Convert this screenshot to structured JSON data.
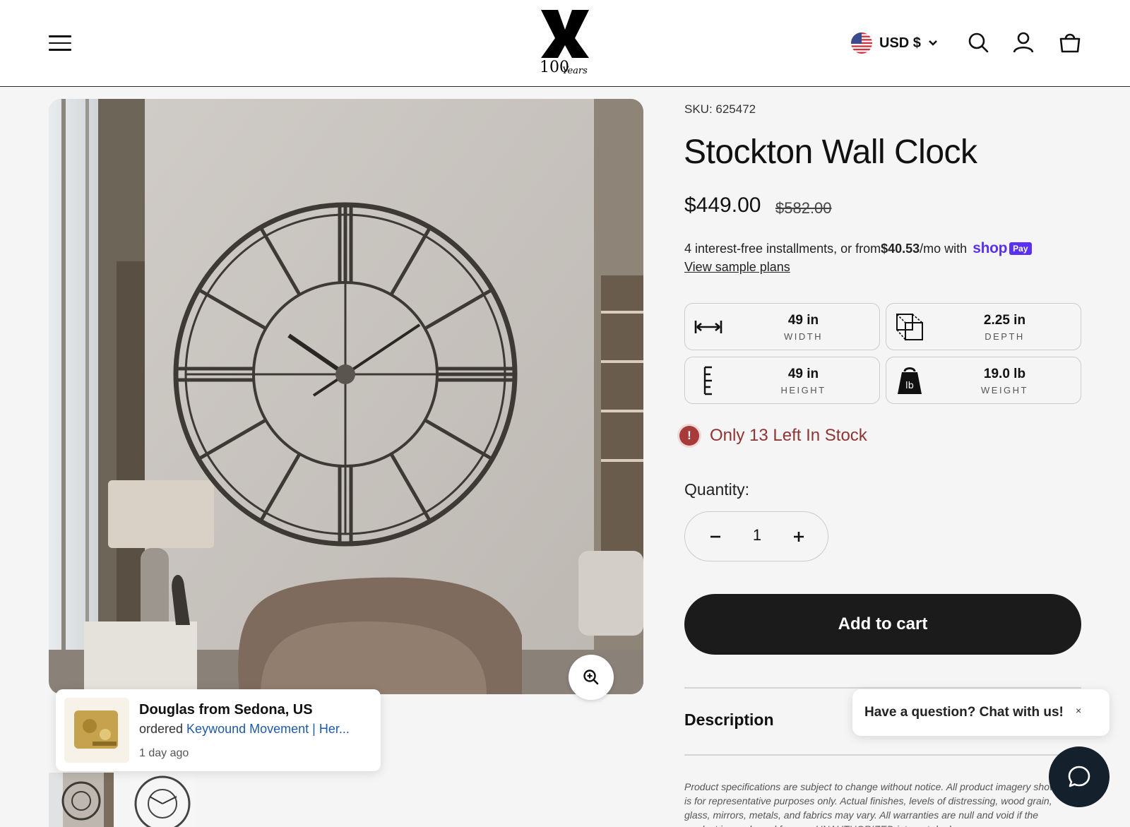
{
  "header": {
    "currency_label": "USD $",
    "logo_text": "100 Years"
  },
  "product": {
    "sku": "SKU: 625472",
    "title": "Stockton Wall Clock",
    "price": "$449.00",
    "compare_price": "$582.00",
    "installments_prefix": "4 interest-free installments, or from ",
    "installments_amount": "$40.53",
    "installments_suffix": "/mo with",
    "shop_logo": "shop",
    "pay_badge": "Pay",
    "sample_plans": "View sample plans",
    "specs": [
      {
        "value": "49 in",
        "label": "WIDTH",
        "icon": "width-arrows-icon"
      },
      {
        "value": "2.25 in",
        "label": "DEPTH",
        "icon": "depth-cube-icon"
      },
      {
        "value": "49 in",
        "label": "HEIGHT",
        "icon": "height-ruler-icon"
      },
      {
        "value": "19.0 lb",
        "label": "WEIGHT",
        "icon": "weight-icon"
      }
    ],
    "stock_text": "Only 13 Left In Stock",
    "quantity_label": "Quantity:",
    "quantity_value": "1",
    "add_to_cart": "Add to cart",
    "description_title": "Description",
    "disclaimer": "Product specifications are subject to change without notice. All product imagery shown is for representative purposes only. Actual finishes, levels of distressing, wood grain, glass, mirrors, metals, and fabrics may vary. All warranties are null and void if the product is purchased from an UNAUTHORIZED internet dealer."
  },
  "popup": {
    "name": "Douglas from Sedona, US",
    "ordered": "ordered ",
    "product_link": "Keywound Movement | Her...",
    "time": "1 day ago"
  },
  "chat": {
    "bubble_text": "Have a question? Chat with us!",
    "close": "×"
  },
  "colors": {
    "accent_dark": "#1b1b1b",
    "stock_red": "#8f3434",
    "shop_purple": "#5a31f4",
    "link_blue": "#1f5aa8"
  }
}
